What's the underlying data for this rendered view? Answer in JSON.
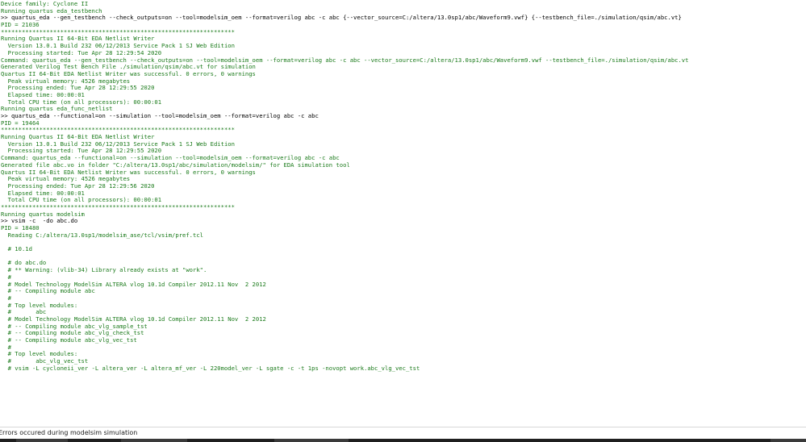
{
  "console": {
    "lines": [
      {
        "text": "Device family: Cyclone II",
        "strong": false
      },
      {
        "text": "Running quartus eda_testbench",
        "strong": false
      },
      {
        "text": ">> quartus_eda --gen_testbench --check_outputs=on --tool=modelsim_oem --format=verilog abc -c abc {--vector_source=C:/altera/13.0sp1/abc/Waveform9.vwf} {--testbench_file=./simulation/qsim/abc.vt}",
        "strong": true
      },
      {
        "text": "PID = 21036",
        "strong": false
      },
      {
        "text": "*******************************************************************",
        "strong": false
      },
      {
        "text": "Running Quartus II 64-Bit EDA Netlist Writer",
        "strong": false
      },
      {
        "text": "  Version 13.0.1 Build 232 06/12/2013 Service Pack 1 SJ Web Edition",
        "strong": false
      },
      {
        "text": "  Processing started: Tue Apr 28 12:29:54 2020",
        "strong": false
      },
      {
        "text": "Command: quartus_eda --gen_testbench --check_outputs=on --tool=modelsim_oem --format=verilog abc -c abc --vector_source=C:/altera/13.0sp1/abc/Waveform9.vwf --testbench_file=./simulation/qsim/abc.vt",
        "strong": false
      },
      {
        "text": "Generated Verilog Test Bench File ./simulation/qsim/abc.vt for simulation",
        "strong": false
      },
      {
        "text": "Quartus II 64-Bit EDA Netlist Writer was successful. 0 errors, 0 warnings",
        "strong": false
      },
      {
        "text": "  Peak virtual memory: 4526 megabytes",
        "strong": false
      },
      {
        "text": "  Processing ended: Tue Apr 28 12:29:55 2020",
        "strong": false
      },
      {
        "text": "  Elapsed time: 00:00:01",
        "strong": false
      },
      {
        "text": "  Total CPU time (on all processors): 00:00:01",
        "strong": false
      },
      {
        "text": "Running quartus eda_func_netlist",
        "strong": false
      },
      {
        "text": ">> quartus_eda --functional=on --simulation --tool=modelsim_oem --format=verilog abc -c abc",
        "strong": true
      },
      {
        "text": "PID = 19464",
        "strong": false
      },
      {
        "text": "*******************************************************************",
        "strong": false
      },
      {
        "text": "Running Quartus II 64-Bit EDA Netlist Writer",
        "strong": false
      },
      {
        "text": "  Version 13.0.1 Build 232 06/12/2013 Service Pack 1 SJ Web Edition",
        "strong": false
      },
      {
        "text": "  Processing started: Tue Apr 28 12:29:55 2020",
        "strong": false
      },
      {
        "text": "Command: quartus_eda --functional=on --simulation --tool=modelsim_oem --format=verilog abc -c abc",
        "strong": false
      },
      {
        "text": "Generated file abc.vo in folder \"C:/altera/13.0sp1/abc/simulation/modelsim/\" for EDA simulation tool",
        "strong": false
      },
      {
        "text": "Quartus II 64-Bit EDA Netlist Writer was successful. 0 errors, 0 warnings",
        "strong": false
      },
      {
        "text": "  Peak virtual memory: 4526 megabytes",
        "strong": false
      },
      {
        "text": "  Processing ended: Tue Apr 28 12:29:56 2020",
        "strong": false
      },
      {
        "text": "  Elapsed time: 00:00:01",
        "strong": false
      },
      {
        "text": "  Total CPU time (on all processors): 00:00:01",
        "strong": false
      },
      {
        "text": "*******************************************************************",
        "strong": false
      },
      {
        "text": "Running quartus modelsim",
        "strong": false
      },
      {
        "text": ">> vsim -c  -do abc.do",
        "strong": true
      },
      {
        "text": "PID = 18480",
        "strong": false
      },
      {
        "text": "  Reading C:/altera/13.0sp1/modelsim_ase/tcl/vsim/pref.tcl",
        "strong": false
      },
      {
        "text": "",
        "strong": false
      },
      {
        "text": "  # 10.1d",
        "strong": false
      },
      {
        "text": "",
        "strong": false
      },
      {
        "text": "  # do abc.do",
        "strong": false
      },
      {
        "text": "  # ** Warning: (vlib-34) Library already exists at \"work\".",
        "strong": false
      },
      {
        "text": "  #",
        "strong": false
      },
      {
        "text": "  # Model Technology ModelSim ALTERA vlog 10.1d Compiler 2012.11 Nov  2 2012",
        "strong": false
      },
      {
        "text": "  # -- Compiling module abc",
        "strong": false
      },
      {
        "text": "  #",
        "strong": false
      },
      {
        "text": "  # Top level modules:",
        "strong": false
      },
      {
        "text": "  #       abc",
        "strong": false
      },
      {
        "text": "  # Model Technology ModelSim ALTERA vlog 10.1d Compiler 2012.11 Nov  2 2012",
        "strong": false
      },
      {
        "text": "  # -- Compiling module abc_vlg_sample_tst",
        "strong": false
      },
      {
        "text": "  # -- Compiling module abc_vlg_check_tst",
        "strong": false
      },
      {
        "text": "  # -- Compiling module abc_vlg_vec_tst",
        "strong": false
      },
      {
        "text": "  #",
        "strong": false
      },
      {
        "text": "  # Top level modules:",
        "strong": false
      },
      {
        "text": "  #       abc_vlg_vec_tst",
        "strong": false
      },
      {
        "text": "  # vsim -L cycloneii_ver -L altera_ver -L altera_mf_ver -L 220model_ver -L sgate -c -t 1ps -novopt work.abc_vlg_vec_tst",
        "strong": false
      }
    ]
  },
  "status": {
    "message": "Errors occured during modelsim simulation"
  },
  "colors": {
    "console_text": "#1a7a1a",
    "command_text": "#000000",
    "background": "#ffffff",
    "taskbar": "#1f1f1f"
  }
}
